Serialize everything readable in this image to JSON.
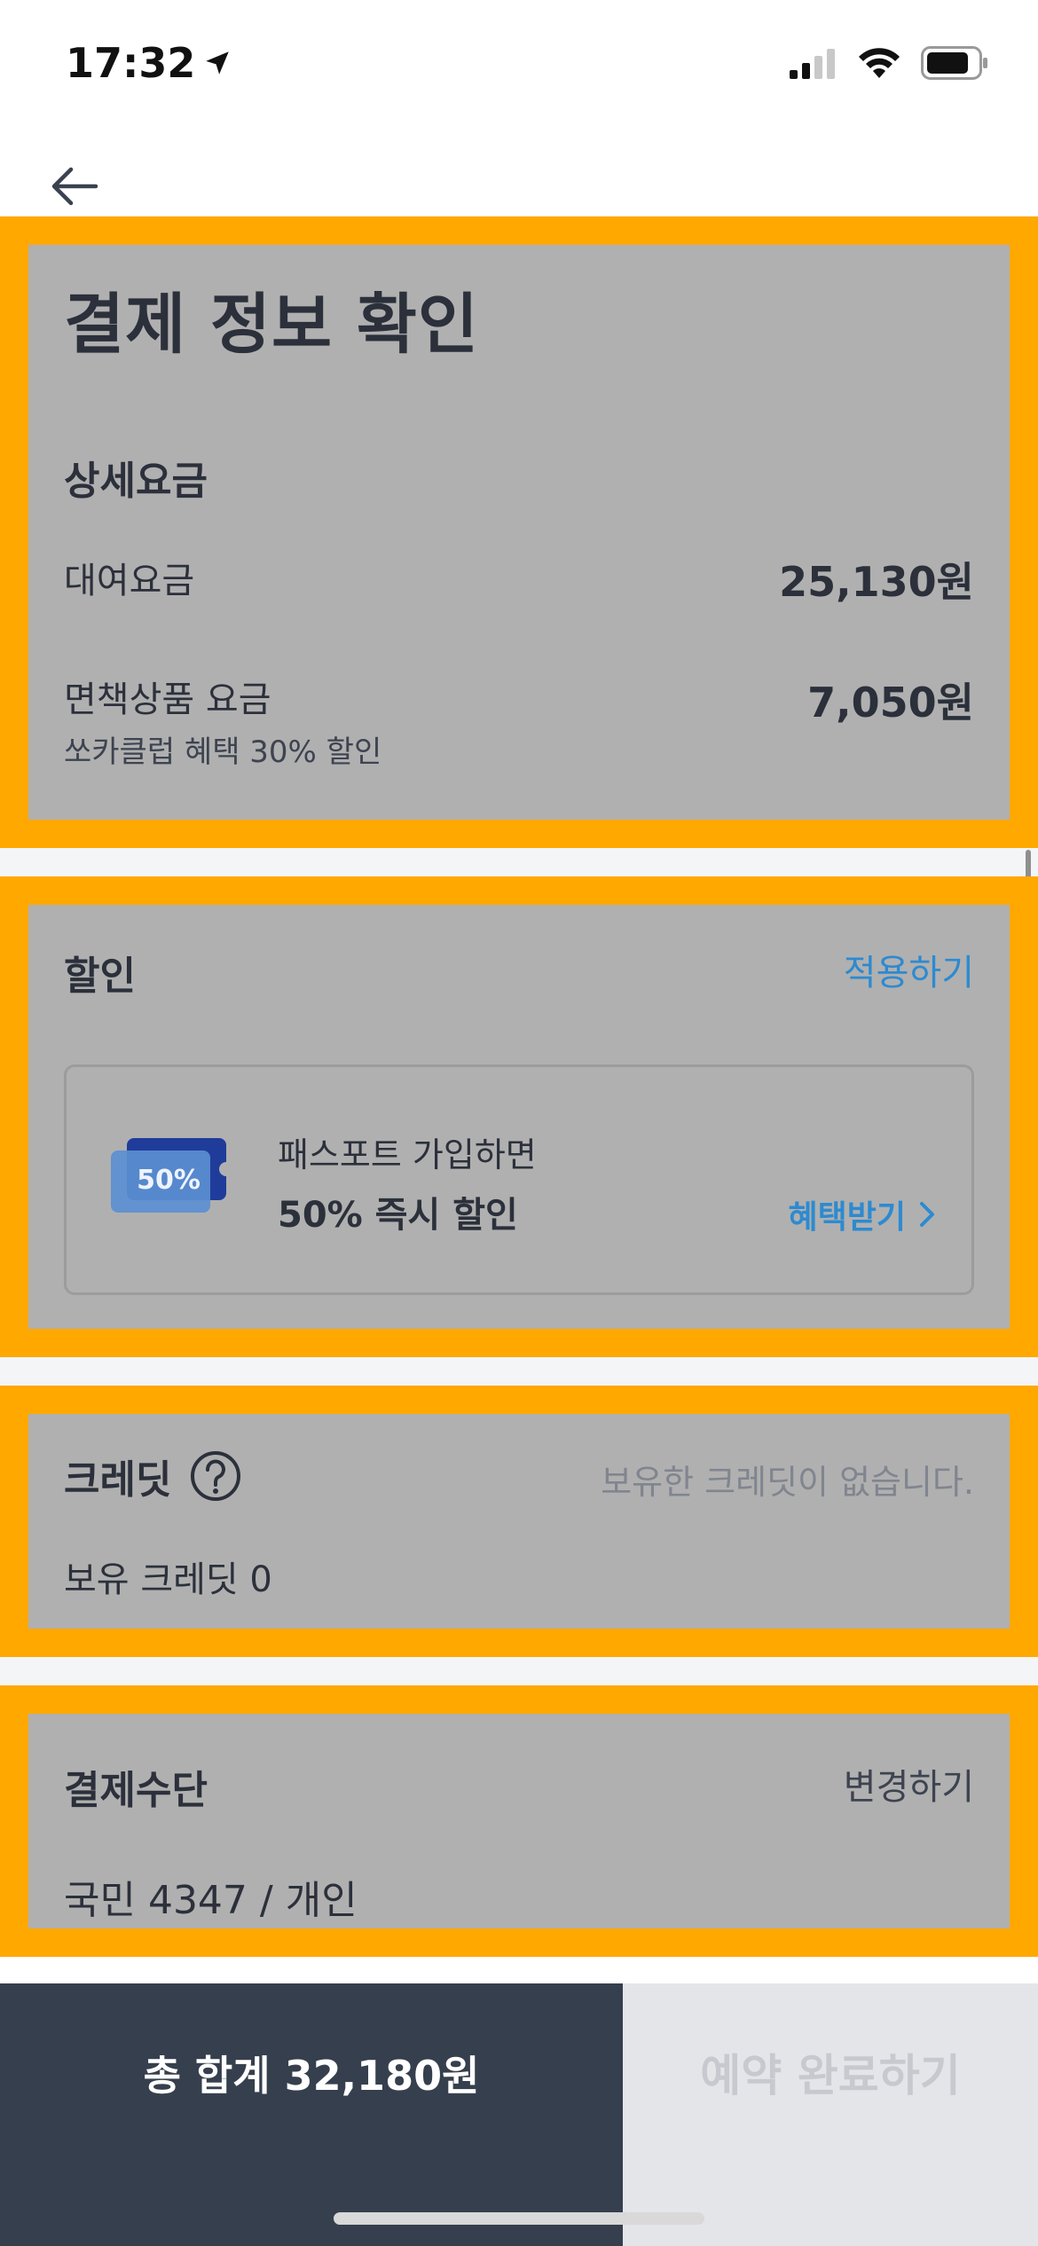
{
  "status_bar": {
    "time": "17:32"
  },
  "page": {
    "title": "결제 정보 확인"
  },
  "details": {
    "heading": "상세요금",
    "rows": [
      {
        "label": "대여요금",
        "amount": "25,130원"
      },
      {
        "label": "면책상품 요금",
        "sub": "쏘카클럽 혜택 30% 할인",
        "amount": "7,050원"
      }
    ]
  },
  "discount": {
    "heading": "할인",
    "apply_label": "적용하기",
    "promo": {
      "badge": "50%",
      "line1": "패스포트 가입하면",
      "line2": "50% 즉시 할인",
      "cta": "혜택받기"
    }
  },
  "credit": {
    "heading": "크레딧",
    "status": "보유한 크레딧이 없습니다.",
    "balance": "보유 크레딧 0"
  },
  "payment": {
    "heading": "결제수단",
    "change_label": "변경하기",
    "method": "국민 4347 / 개인"
  },
  "bottom": {
    "total": "총 합계 32,180원",
    "confirm": "예약 완료하기"
  },
  "colors": {
    "highlight": "#ffa800",
    "panel": "#b0b0b0",
    "accent_blue": "#2d8ad0",
    "bottom_dark": "#363f4d"
  }
}
